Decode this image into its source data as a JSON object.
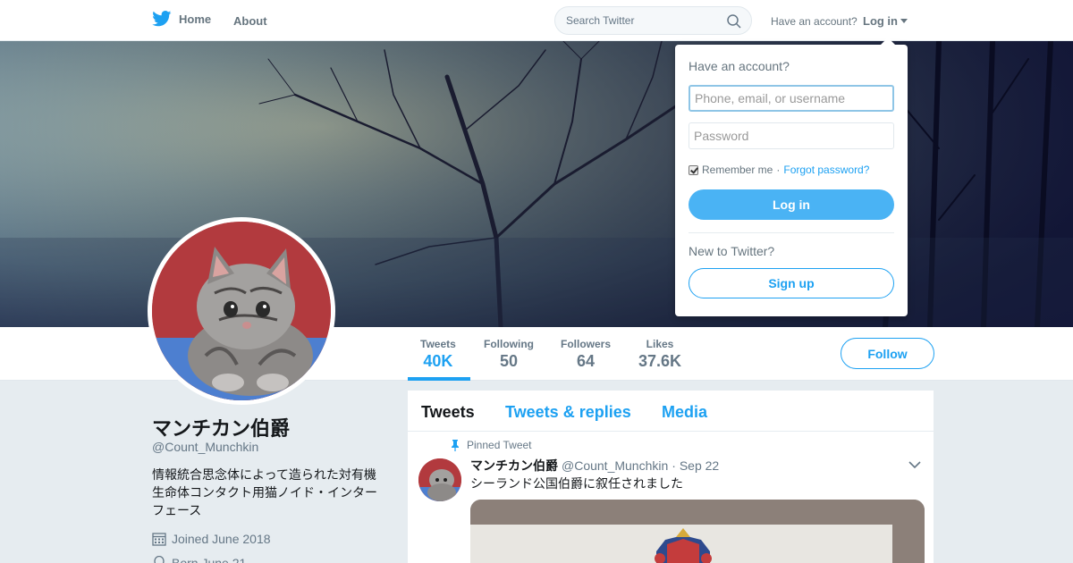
{
  "nav": {
    "home_label": "Home",
    "about_label": "About",
    "search_placeholder": "Search Twitter",
    "have_account": "Have an account?",
    "login_label": "Log in"
  },
  "profile": {
    "name": "マンチカン伯爵",
    "handle": "@Count_Munchkin",
    "bio": "情報統合思念体によって造られた対有機生命体コンタクト用猫ノイド・インターフェース",
    "joined": "Joined June 2018",
    "born": "Born June 21"
  },
  "stats": [
    {
      "label": "Tweets",
      "value": "40K"
    },
    {
      "label": "Following",
      "value": "50"
    },
    {
      "label": "Followers",
      "value": "64"
    },
    {
      "label": "Likes",
      "value": "37.6K"
    }
  ],
  "follow_label": "Follow",
  "timeline": {
    "tabs": [
      "Tweets",
      "Tweets & replies",
      "Media"
    ],
    "pinned_label": "Pinned Tweet",
    "tweet": {
      "name": "マンチカン伯爵",
      "handle": "@Count_Munchkin",
      "date": "· Sep 22",
      "text": "シーランド公国伯爵に叙任されました"
    }
  },
  "login_dropdown": {
    "title": "Have an account?",
    "username_placeholder": "Phone, email, or username",
    "password_placeholder": "Password",
    "remember_me": "Remember me",
    "separator": "·",
    "forgot": "Forgot password?",
    "login_button": "Log in",
    "new_to": "New to Twitter?",
    "signup_button": "Sign up"
  },
  "colors": {
    "accent": "#1da1f2",
    "login_button": "#4ab3f4",
    "page_bg": "#e6ecf0"
  },
  "icons": [
    "twitter-bird-icon",
    "search-icon",
    "caret-down-icon",
    "pin-icon",
    "calendar-icon",
    "balloon-icon",
    "chevron-down-icon"
  ]
}
